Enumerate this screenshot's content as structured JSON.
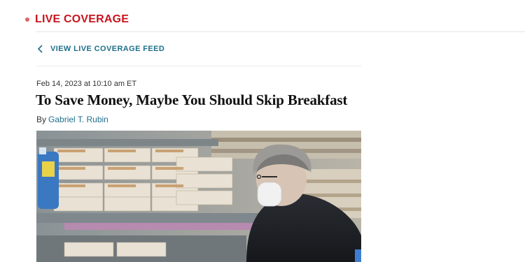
{
  "live": {
    "label": "LIVE COVERAGE"
  },
  "nav": {
    "back_label": "VIEW LIVE COVERAGE FEED"
  },
  "article": {
    "timestamp": "Feb 14, 2023 at 10:10 am ET",
    "headline": "To Save Money, Maybe You Should Skip Breakfast",
    "byline_prefix": "By",
    "author": "Gabriel T. Rubin"
  },
  "colors": {
    "live_red": "#c8141e",
    "link_teal": "#1f6f8b"
  }
}
